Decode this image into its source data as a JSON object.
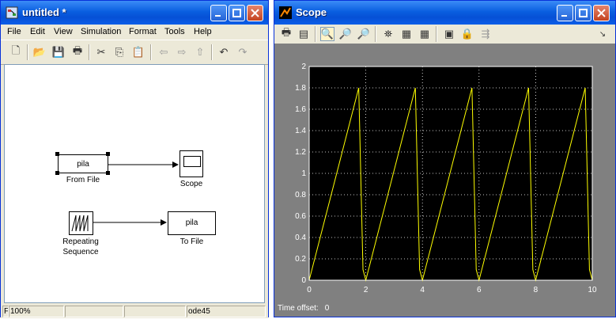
{
  "left_window": {
    "title": "untitled *",
    "menu": [
      "File",
      "Edit",
      "View",
      "Simulation",
      "Format",
      "Tools",
      "Help"
    ],
    "blocks": {
      "from_file": {
        "text": "pila",
        "label": "From File"
      },
      "scope": {
        "label": "Scope"
      },
      "repeating": {
        "label_line1": "Repeating",
        "label_line2": "Sequence"
      },
      "to_file": {
        "text": "pila",
        "label": "To File"
      }
    },
    "status": {
      "f": "F",
      "zoom": "100%",
      "solver": "ode45"
    }
  },
  "right_window": {
    "title": "Scope",
    "time_offset_label": "Time offset:",
    "time_offset_value": "0"
  },
  "colors": {
    "titlebar": "#0a5fe0",
    "plot_bg": "#000000",
    "trace": "#ffff00",
    "frame": "#808080"
  },
  "chart_data": {
    "type": "line",
    "x": [
      0,
      1.75,
      1.9,
      2,
      3.75,
      3.9,
      4,
      5.75,
      5.9,
      6,
      7.75,
      7.9,
      8,
      9.75,
      9.9,
      10
    ],
    "y": [
      0,
      1.8,
      0.1,
      0,
      1.8,
      0.1,
      0,
      1.8,
      0.1,
      0,
      1.8,
      0.1,
      0,
      1.8,
      0.1,
      0
    ],
    "xlim": [
      0,
      10
    ],
    "ylim": [
      0,
      2
    ],
    "xticks": [
      "0",
      "2",
      "4",
      "6",
      "8",
      "10"
    ],
    "yticks": [
      "0",
      "0.2",
      "0.4",
      "0.6",
      "0.8",
      "1",
      "1.2",
      "1.4",
      "1.6",
      "1.8",
      "2"
    ],
    "grid": true,
    "title": "",
    "xlabel": "",
    "ylabel": ""
  }
}
